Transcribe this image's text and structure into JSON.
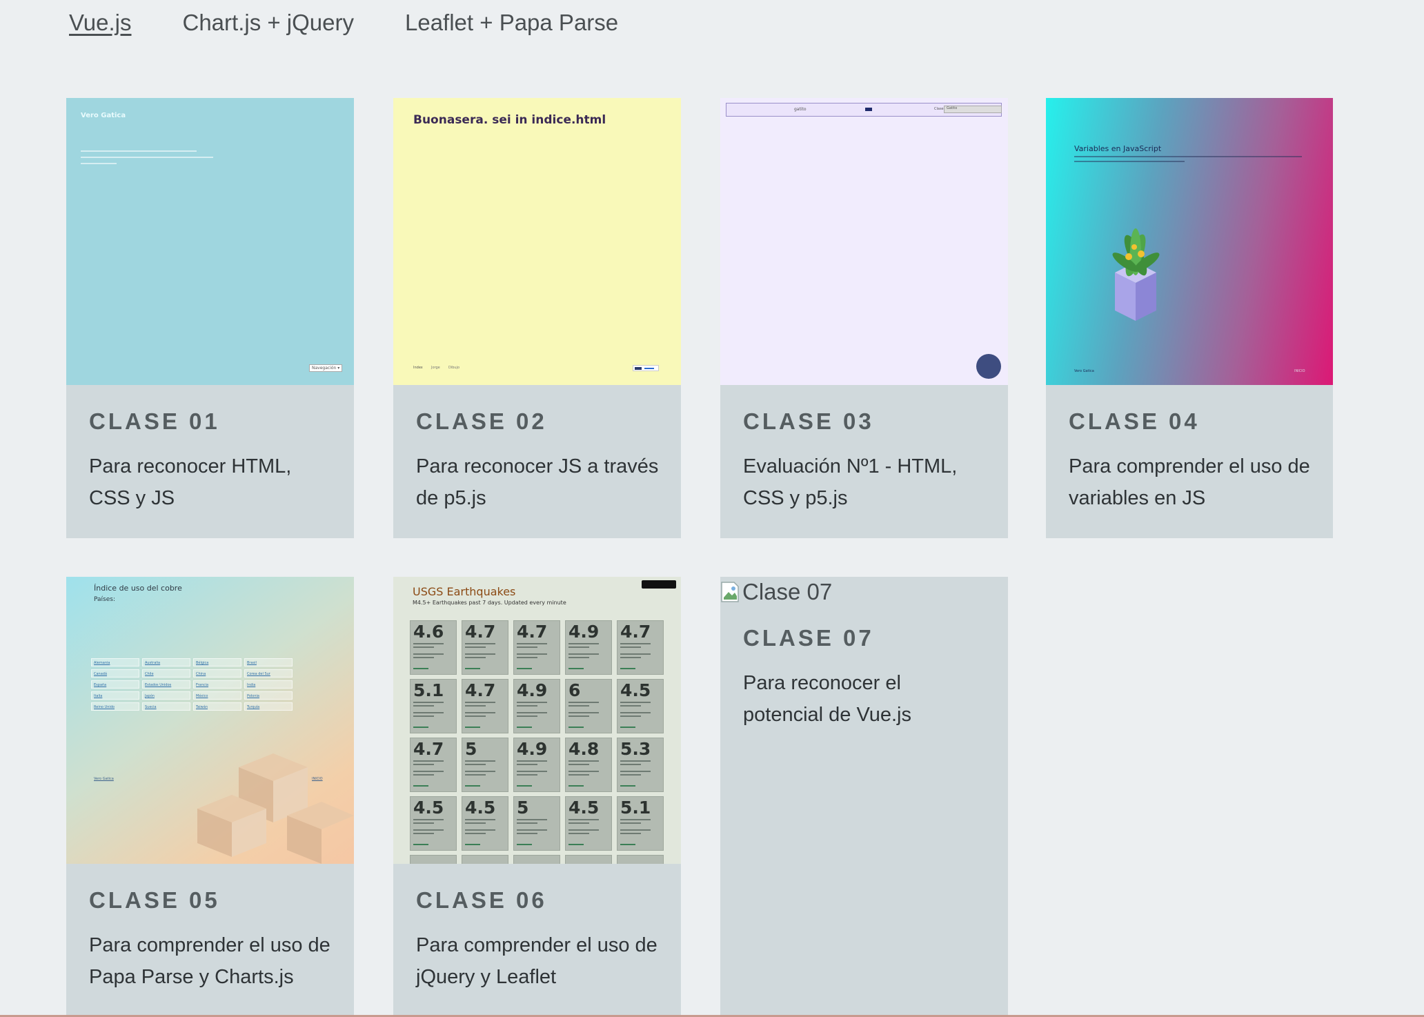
{
  "nav": {
    "items": [
      "Vue.js",
      "Chart.js + jQuery",
      "Leaflet + Papa Parse"
    ],
    "active_index": 0
  },
  "cards": [
    {
      "clase": "CLASE 01",
      "description": "Para reconocer HTML, CSS y JS",
      "thumb": {
        "title": "Vero Gatica",
        "line1": "🧡 Como en el ramo anterior, mi ...",
        "button": "Navegación ▾"
      }
    },
    {
      "clase": "CLASE 02",
      "description": "Para reconocer JS a través de p5.js",
      "thumb": {
        "heading": "Buonasera. sei in indice.html",
        "nav": [
          "Index",
          "Jorge",
          "Dibujo"
        ]
      }
    },
    {
      "clase": "CLASE 03",
      "description": "Evaluación Nº1 - HTML, CSS y p5.js",
      "thumb": {
        "center_label": "gatito",
        "select_label": "Clase",
        "select_value": "Gatito"
      }
    },
    {
      "clase": "CLASE 04",
      "description": "Para comprender el uso de variables en JS",
      "thumb": {
        "heading": "Variables en JavaScript",
        "footer_left": "Vero Gatica",
        "footer_right": "INICIO"
      }
    },
    {
      "clase": "CLASE 05",
      "description": "Para comprender el uso de Papa Parse y Charts.js",
      "thumb": {
        "heading": "Índice de uso del cobre",
        "subheading": "Países:",
        "countries": [
          "Alemania",
          "Australia",
          "Bélgica",
          "Brasil",
          "Canadá",
          "Chile",
          "China",
          "Corea del Sur",
          "España",
          "Estados Unidos",
          "Francia",
          "India",
          "Italia",
          "Japón",
          "México",
          "Polonia",
          "Reino Unido",
          "Suecia",
          "Taiwán",
          "Turquía"
        ],
        "footer_left": "Vero Gatica",
        "footer_right": "INICIO"
      }
    },
    {
      "clase": "CLASE 06",
      "description": "Para comprender el uso de jQuery y Leaflet",
      "thumb": {
        "heading": "USGS Earthquakes",
        "subheading": "M4.5+ Earthquakes past 7 days. Updated every minute",
        "magnitudes": [
          "4.6",
          "4.7",
          "4.7",
          "4.9",
          "4.7",
          "5.1",
          "4.7",
          "4.9",
          "6",
          "4.5",
          "4.7",
          "5",
          "4.9",
          "4.8",
          "5.3",
          "4.5",
          "4.5",
          "5",
          "4.5",
          "5.1"
        ]
      }
    },
    {
      "clase": "CLASE 07",
      "description": "Para reconocer el potencial de Vue.js",
      "thumb": {
        "alt": "Clase 07"
      }
    }
  ]
}
